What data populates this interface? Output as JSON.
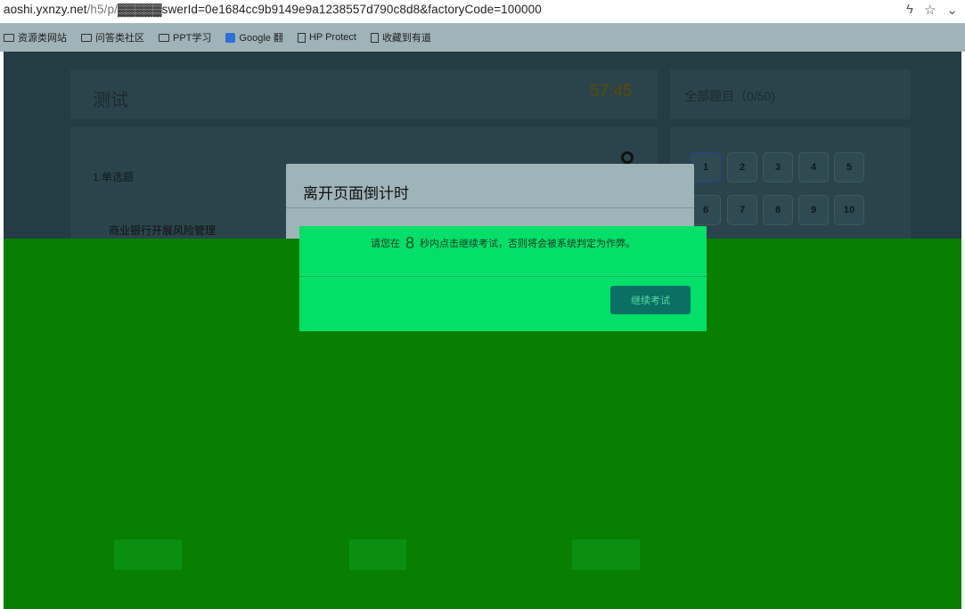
{
  "browser": {
    "url_host": "aoshi.yxnzy.net",
    "url_path": "/h5/p/",
    "url_query": "swerId=0e1684cc9b9149e9a1238557d790c8d8&factoryCode=100000",
    "right_icons": [
      "lightning-icon",
      "star-icon",
      "chevron-down-icon"
    ],
    "bookmarks": [
      {
        "icon": "folder-icon",
        "label": "资源类网站"
      },
      {
        "icon": "folder-icon",
        "label": "问答类社区"
      },
      {
        "icon": "folder-icon",
        "label": "PPT学习"
      },
      {
        "icon": "google-translate-icon",
        "label": "Google 翻"
      },
      {
        "icon": "page-icon",
        "label": "HP Protect"
      },
      {
        "icon": "page-icon",
        "label": "收藏到有道"
      }
    ]
  },
  "exam": {
    "title": "测试",
    "timer": "57:45",
    "all_questions": "全部题目（0/50)",
    "question_type": "1.单选题",
    "question_text": "商业银行开展风险管理",
    "question_numbers": [
      "1",
      "2",
      "3",
      "4",
      "5",
      "6",
      "7",
      "8",
      "9",
      "10"
    ]
  },
  "dialog": {
    "title": "离开页面倒计时",
    "message_before": "请您在",
    "countdown": "8",
    "message_after": "秒内点击继续考试，否则将会被系统判定为作弊。",
    "continue_label": "继续考试"
  },
  "colors": {
    "overlay_green": "#087f00",
    "dialog_green": "#04df6a",
    "button_teal": "#0b6f63"
  }
}
